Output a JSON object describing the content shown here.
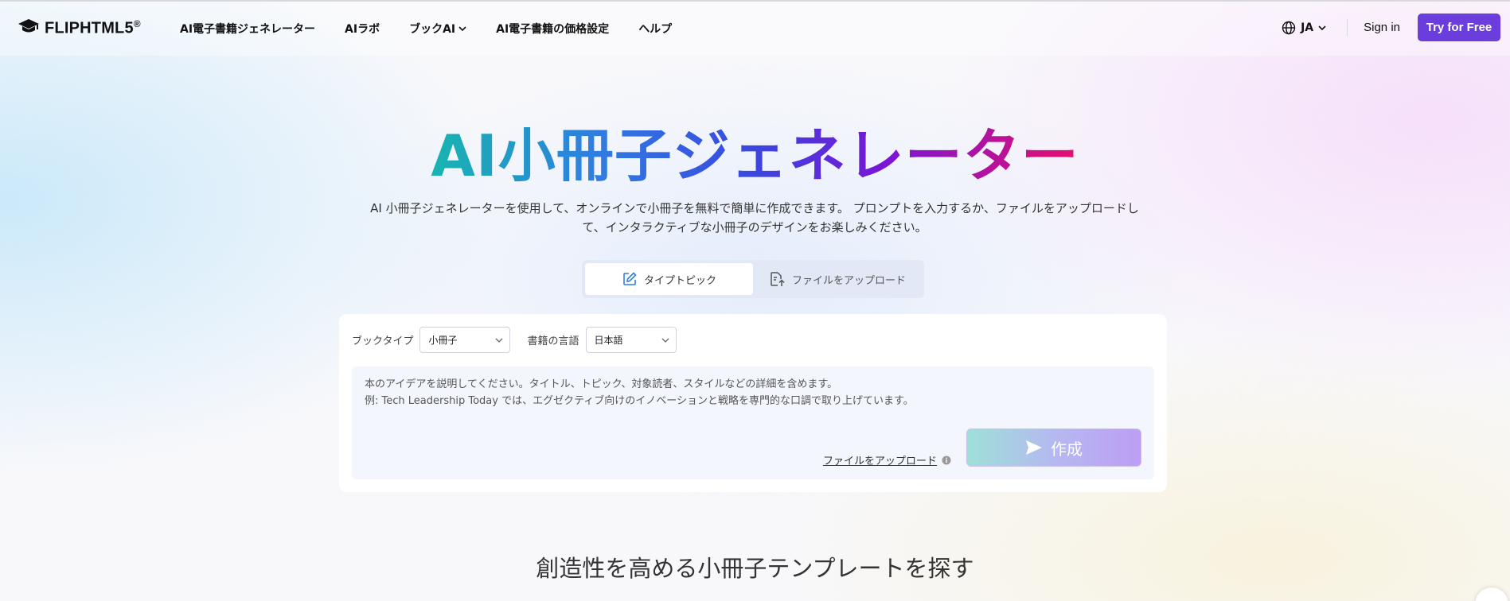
{
  "header": {
    "logo_text": "FLIPHTML5",
    "logo_mark": "®",
    "nav": [
      {
        "label": "AI電子書籍ジェネレーター",
        "has_dropdown": false
      },
      {
        "label": "AIラボ",
        "has_dropdown": false
      },
      {
        "label": "ブックAI",
        "has_dropdown": true
      },
      {
        "label": "AI電子書籍の価格設定",
        "has_dropdown": false
      },
      {
        "label": "ヘルプ",
        "has_dropdown": false
      }
    ],
    "language": "JA",
    "signin": "Sign in",
    "try_free": "Try for Free"
  },
  "hero": {
    "title": "AI小冊子ジェネレーター",
    "subtitle": "AI 小冊子ジェネレーターを使用して、オンラインで小冊子を無料で簡単に作成できます。 プロンプトを入力するか、ファイルをアップロードして、インタラクティブな小冊子のデザインをお楽しみください。"
  },
  "tabs": [
    {
      "label": "タイプトピック",
      "icon": "edit-icon",
      "active": true
    },
    {
      "label": "ファイルをアップロード",
      "icon": "upload-file-icon",
      "active": false
    }
  ],
  "form": {
    "book_type_label": "ブックタイプ",
    "book_type_value": "小冊子",
    "language_label": "書籍の言語",
    "language_value": "日本語",
    "prompt_placeholder": "本のアイデアを説明してください。タイトル、トピック、対象読者、スタイルなどの詳細を含めます。\n例: Tech Leadership Today では、エグゼクティブ向けのイノベーションと戦略を専門的な口調で取り上げています。",
    "upload_link": "ファイルをアップロード",
    "create_button": "作成"
  },
  "section": {
    "title": "創造性を高める小冊子テンプレートを探す"
  },
  "colors": {
    "accent": "#6a3ddc",
    "title_gradient": [
      "#17b5b0",
      "#2f7ee0",
      "#3b45e0",
      "#7a16d4",
      "#e6106e"
    ]
  }
}
